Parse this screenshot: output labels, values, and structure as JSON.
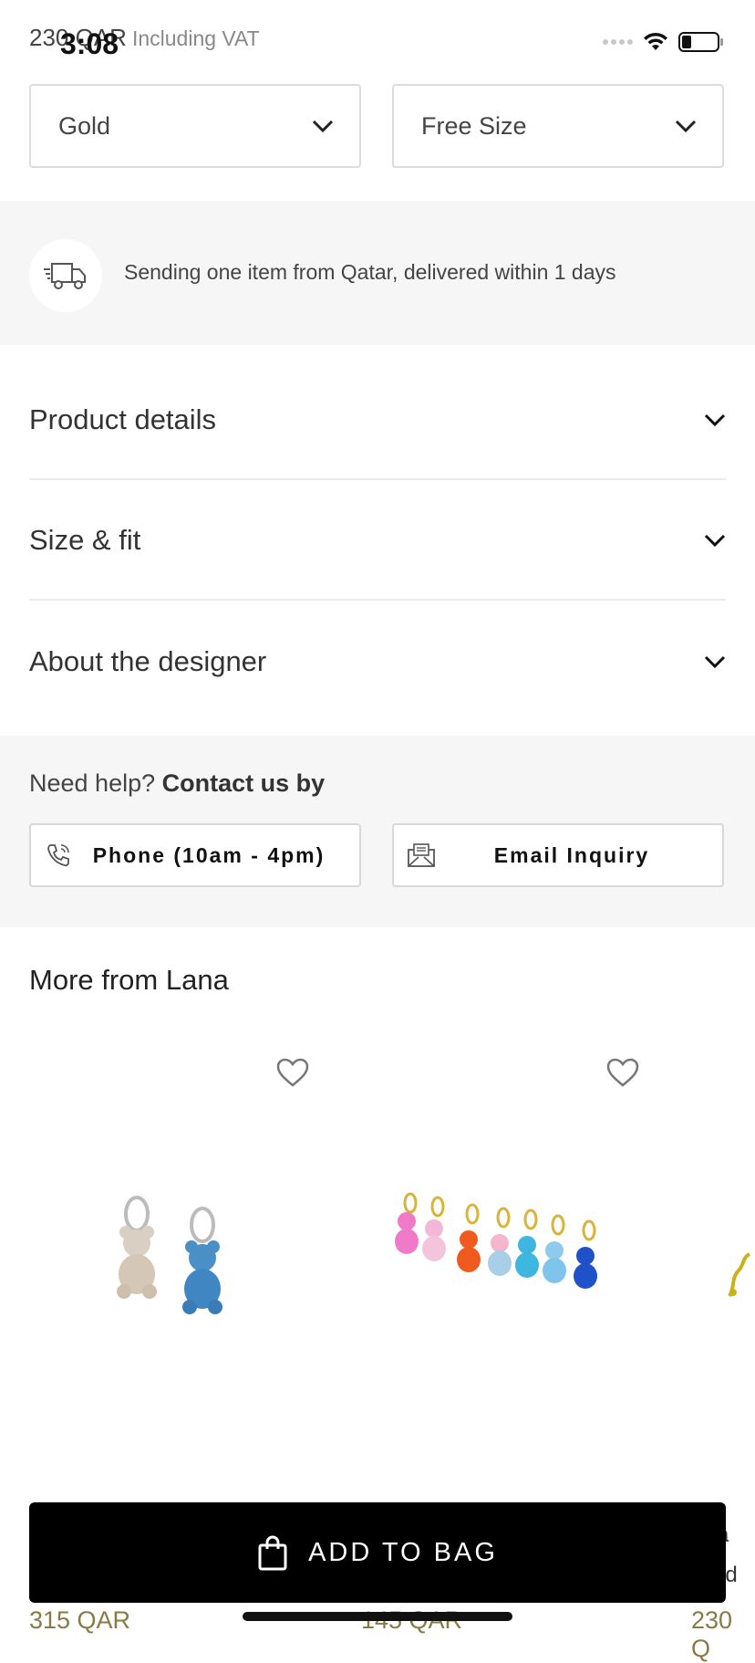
{
  "status_bar": {
    "time": "3:08"
  },
  "product": {
    "price": "230 QAR",
    "vat_note": "Including VAT"
  },
  "selectors": [
    {
      "value": "Gold"
    },
    {
      "value": "Free Size"
    }
  ],
  "delivery": {
    "text": "Sending one item from Qatar, delivered within 1 days"
  },
  "accordion": [
    {
      "label": "Product details"
    },
    {
      "label": "Size & fit"
    },
    {
      "label": "About the designer"
    }
  ],
  "help": {
    "prefix": "Need help?",
    "bold": "Contact us by",
    "phone_label": "Phone (10am - 4pm)",
    "email_label": "Email Inquiry"
  },
  "more_from": {
    "title": "More from Lana",
    "products": [
      {
        "price": "315 QAR"
      },
      {
        "price": "145 QAR"
      },
      {
        "price": "230 Q"
      }
    ],
    "third_partial": {
      "name_fragment": "a",
      "color_fragment": "ld"
    }
  },
  "cta": {
    "label": "ADD TO BAG"
  },
  "colors": {
    "cta_bg": "#000000",
    "price_color": "#8a7a45",
    "panel_bg": "#f6f6f6"
  }
}
